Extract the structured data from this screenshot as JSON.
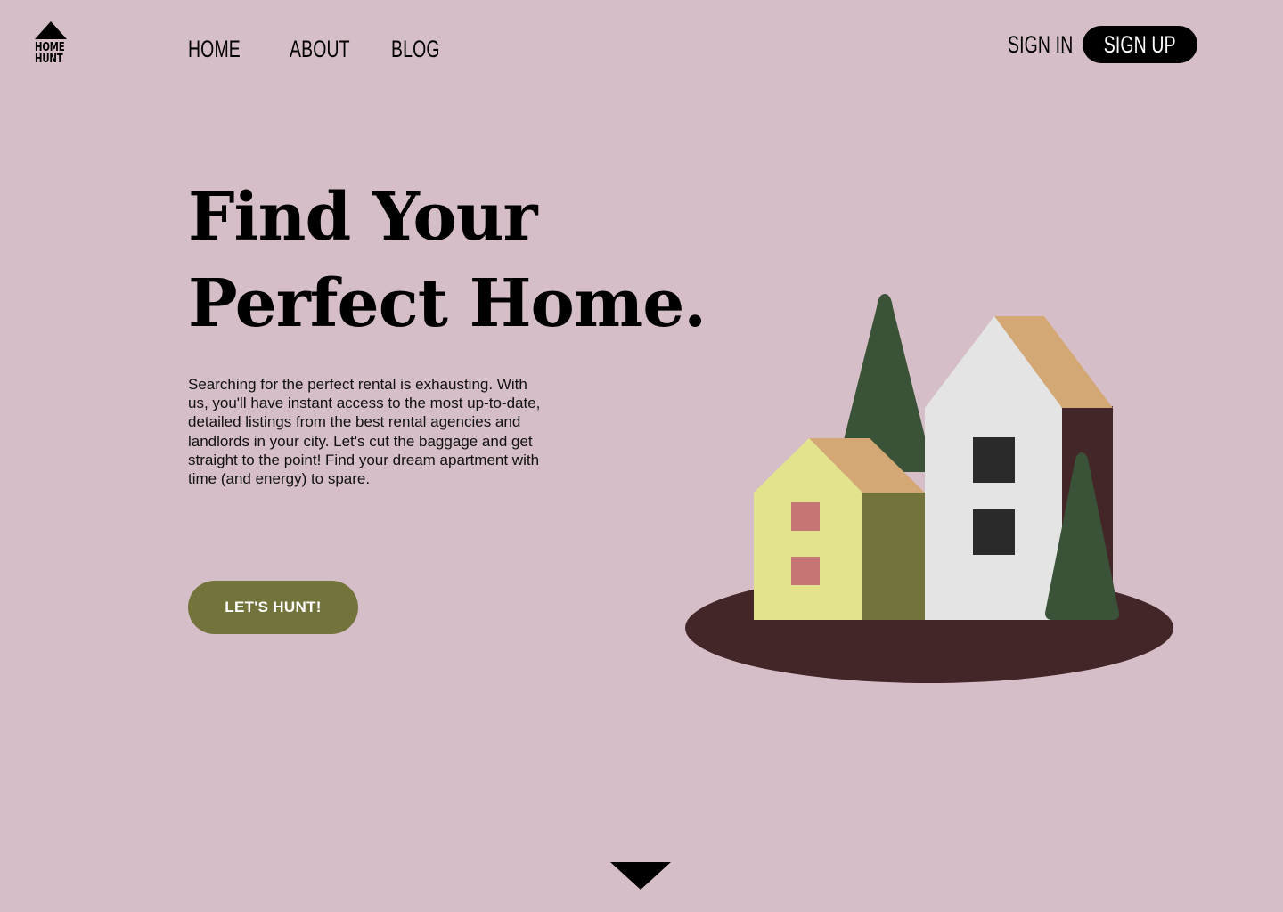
{
  "brand": {
    "logo_line1": "HOME",
    "logo_line2": "HUNT",
    "icon": "house-roof-icon"
  },
  "nav": {
    "items": [
      {
        "label": "HOME"
      },
      {
        "label": "ABOUT"
      },
      {
        "label": "BLOG"
      }
    ]
  },
  "auth": {
    "sign_in": "SIGN IN",
    "sign_up": "SIGN UP"
  },
  "hero": {
    "headline_line1": "Find Your",
    "headline_line2": "Perfect Home.",
    "body": "Searching for the perfect rental is exhausting. With us, you'll have instant access to the most up-to-date, detailed listings from the best rental agencies and landlords in your city.  Let's cut the baggage and get straight to the point! Find your dream apartment with time (and energy) to spare.",
    "cta_label": "LET'S HUNT!"
  },
  "scroll": {
    "icon": "scroll-down-arrow-icon"
  },
  "colors": {
    "background": "#d6bec8",
    "cta": "#73743c",
    "ground": "#432628",
    "tree": "#3a5238",
    "roof": "#d4a874",
    "house_small": "#e3e38e",
    "house_small_side": "#73743c",
    "house_tall": "#e4e4e4",
    "house_tall_side": "#432628",
    "window_small": "#c67474",
    "window_tall": "#2b2a2a"
  }
}
